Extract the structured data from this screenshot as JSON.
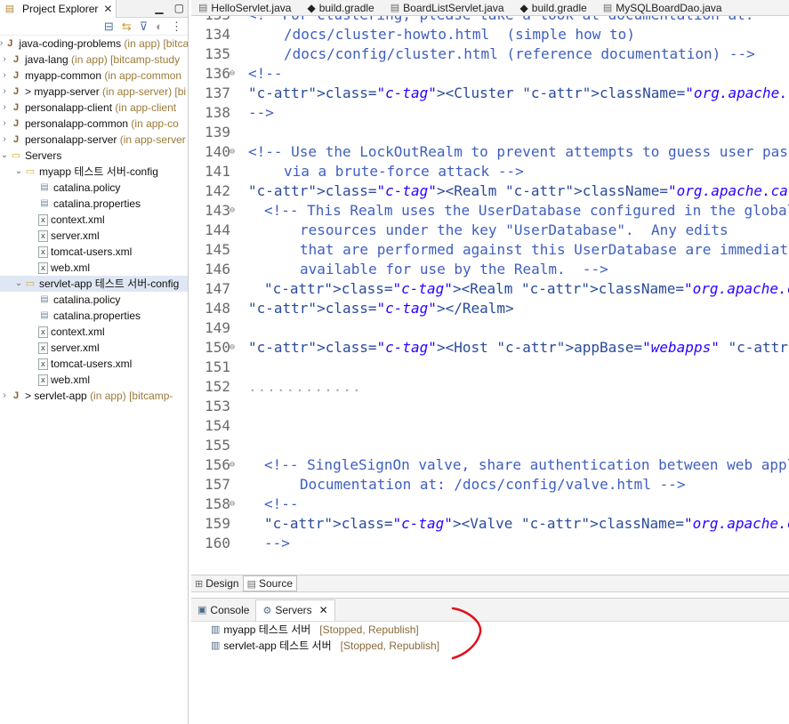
{
  "explorer": {
    "title": "Project Explorer",
    "close": "✕",
    "items": [
      {
        "label": "java-coding-problems",
        "decoration": "(in app) [bitcamp-study"
      },
      {
        "label": "java-lang",
        "decoration": "(in app) [bitcamp-study"
      },
      {
        "label": "myapp-common",
        "decoration": "(in app-common"
      },
      {
        "label": "myapp-server",
        "decoration": "(in app-server) [bi"
      },
      {
        "label": "personalapp-client",
        "decoration": "(in app-client"
      },
      {
        "label": "personalapp-common",
        "decoration": "(in app-co"
      },
      {
        "label": "personalapp-server",
        "decoration": "(in app-server"
      },
      {
        "label": "Servers",
        "decoration": ""
      },
      {
        "label": "myapp 테스트 서버-config",
        "decoration": ""
      },
      {
        "label": "catalina.policy",
        "decoration": ""
      },
      {
        "label": "catalina.properties",
        "decoration": ""
      },
      {
        "label": "context.xml",
        "decoration": ""
      },
      {
        "label": "server.xml",
        "decoration": ""
      },
      {
        "label": "tomcat-users.xml",
        "decoration": ""
      },
      {
        "label": "web.xml",
        "decoration": ""
      },
      {
        "label": "servlet-app 테스트 서버-config",
        "decoration": ""
      },
      {
        "label": "catalina.policy",
        "decoration": ""
      },
      {
        "label": "catalina.properties",
        "decoration": ""
      },
      {
        "label": "context.xml",
        "decoration": ""
      },
      {
        "label": "server.xml",
        "decoration": ""
      },
      {
        "label": "tomcat-users.xml",
        "decoration": ""
      },
      {
        "label": "web.xml",
        "decoration": ""
      },
      {
        "label": "servlet-app",
        "decoration": "(in app) [bitcamp-"
      }
    ]
  },
  "editor": {
    "tabs": [
      "HelloServlet.java",
      "build.gradle",
      "BoardListServlet.java",
      "build.gradle",
      "MySQLBoardDao.java"
    ],
    "lines": [
      {
        "n": "133",
        "text": "<!--For clustering, please take a look at documentation at:"
      },
      {
        "n": "134",
        "text": "/docs/cluster-howto.html  (simple how to)"
      },
      {
        "n": "135",
        "text": "/docs/config/cluster.html (reference documentation) -->"
      },
      {
        "n": "136",
        "text": "<!--"
      },
      {
        "n": "137",
        "text": "<Cluster className=\"org.apache.catalina.ha.tcp.SimpleTcpCluster\"/>"
      },
      {
        "n": "138",
        "text": "-->"
      },
      {
        "n": "139",
        "text": ""
      },
      {
        "n": "140",
        "text": "<!-- Use the LockOutRealm to prevent attempts to guess user passwords"
      },
      {
        "n": "141",
        "text": "via a brute-force attack -->"
      },
      {
        "n": "142",
        "text": "<Realm className=\"org.apache.catalina.realm.LockOutRealm\">"
      },
      {
        "n": "143",
        "text": "<!-- This Realm uses the UserDatabase configured in the global JNDI"
      },
      {
        "n": "144",
        "text": "resources under the key \"UserDatabase\".  Any edits"
      },
      {
        "n": "145",
        "text": "that are performed against this UserDatabase are immediately"
      },
      {
        "n": "146",
        "text": "available for use by the Realm.  -->"
      },
      {
        "n": "147",
        "text": "<Realm className=\"org.apache.catalina.realm.UserDatabaseRealm\""
      },
      {
        "n": "148",
        "text": "</Realm>"
      },
      {
        "n": "149",
        "text": ""
      },
      {
        "n": "150",
        "text": "<Host appBase=\"webapps\" autoDeploy=\"true\" name=\"localhost\" unpackWARs=\"true\">"
      },
      {
        "n": "151",
        "text": ""
      },
      {
        "n": "152",
        "text": "............"
      },
      {
        "n": "153",
        "text": ""
      },
      {
        "n": "154",
        "text": ""
      },
      {
        "n": "155",
        "text": ""
      },
      {
        "n": "156",
        "text": "<!-- SingleSignOn valve, share authentication between web applications"
      },
      {
        "n": "157",
        "text": "Documentation at: /docs/config/valve.html -->"
      },
      {
        "n": "158",
        "text": "<!--"
      },
      {
        "n": "159",
        "text": "<Valve className=\"org.apache.catalina.authenticator.SingleSignOn\" />"
      },
      {
        "n": "160",
        "text": "-->"
      }
    ]
  },
  "design_source": {
    "design": "Design",
    "source": "Source"
  },
  "views": {
    "console": "Console",
    "servers": "Servers",
    "close": "✕",
    "server_rows": [
      {
        "name": "myapp 테스트 서버",
        "status": "[Stopped, Republish]"
      },
      {
        "name": "servlet-app 테스트 서버",
        "status": "[Stopped, Republish]"
      }
    ]
  },
  "colors": {
    "annotation": "#e0101a"
  }
}
